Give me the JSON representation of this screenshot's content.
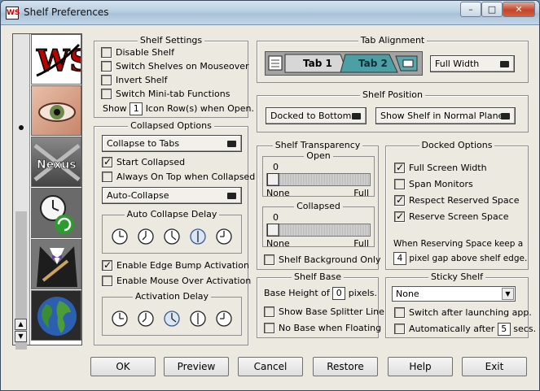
{
  "window": {
    "title": "Shelf Preferences"
  },
  "sidebar": {
    "icons": [
      "ws-logo-icon",
      "eye-icon",
      "nexus-icon",
      "clock-recycle-icon",
      "tuxedo-icon",
      "globe-icon"
    ]
  },
  "shelf_settings": {
    "title": "Shelf Settings",
    "options": [
      {
        "label": "Disable Shelf",
        "checked": false
      },
      {
        "label": "Switch Shelves on Mouseover",
        "checked": false
      },
      {
        "label": "Invert Shelf",
        "checked": false
      },
      {
        "label": "Switch Mini-tab Functions",
        "checked": false
      }
    ],
    "show_prefix": "Show",
    "show_value": "1",
    "show_suffix": "Icon Row(s) when Open."
  },
  "collapsed_options": {
    "title": "Collapsed Options",
    "collapse_mode": "Collapse to Tabs",
    "start_collapsed": "Start Collapsed",
    "always_on_top": "Always On Top when Collapsed",
    "auto_mode": "Auto-Collapse",
    "auto_delay_title": "Auto Collapse Delay",
    "edge_bump": "Enable Edge Bump Activation",
    "mouse_over": "Enable Mouse Over Activation",
    "activation_delay_title": "Activation Delay"
  },
  "tab_alignment": {
    "title": "Tab Alignment",
    "tab1": "Tab 1",
    "tab2": "Tab 2",
    "width_mode": "Full Width"
  },
  "shelf_position": {
    "title": "Shelf Position",
    "dock": "Docked to Bottom",
    "plane": "Show Shelf in Normal Plane"
  },
  "transparency": {
    "title": "Shelf Transparency",
    "open": {
      "title": "Open",
      "value": "0",
      "min_label": "None",
      "max_label": "Full",
      "level": 0
    },
    "collapsed": {
      "title": "Collapsed",
      "value": "0",
      "min_label": "None",
      "max_label": "Full",
      "level": 0
    },
    "background_only": "Shelf Background Only"
  },
  "docked_options": {
    "title": "Docked Options",
    "full_width": "Full Screen Width",
    "span_monitors": "Span Monitors",
    "respect_reserved": "Respect Reserved Space",
    "reserve_screen": "Reserve Screen Space",
    "gap_text_1": "When Reserving Space keep a",
    "gap_value": "4",
    "gap_text_2": "pixel gap above shelf edge."
  },
  "shelf_base": {
    "title": "Shelf Base",
    "height_prefix": "Base Height of",
    "height_value": "0",
    "height_suffix": "pixels.",
    "splitter": "Show Base Splitter Line",
    "no_base": "No Base when Floating"
  },
  "sticky_shelf": {
    "title": "Sticky Shelf",
    "selected": "None",
    "switch_after": "Switch after launching app.",
    "auto_prefix": "Automatically after",
    "auto_value": "5",
    "auto_suffix": "secs."
  },
  "buttons": {
    "ok": "OK",
    "preview": "Preview",
    "cancel": "Cancel",
    "restore": "Restore",
    "help": "Help",
    "exit": "Exit"
  }
}
